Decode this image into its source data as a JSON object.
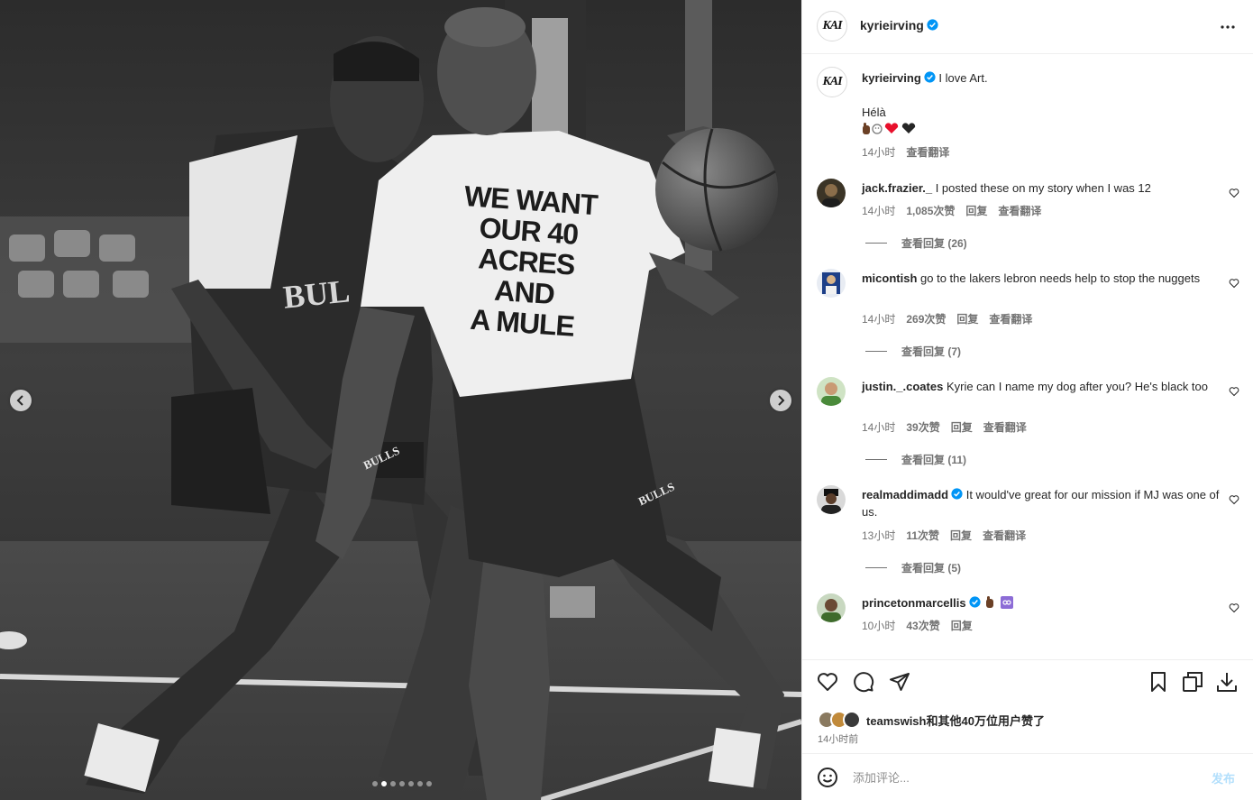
{
  "post": {
    "author": "kyrieirving",
    "avatar_logo": "KAI",
    "caption_line1": "I love Art.",
    "caption_line2": "Hélà",
    "caption_time": "14小时",
    "caption_translate": "查看翻译"
  },
  "media": {
    "shirt_lines": [
      "WE WANT",
      "OUR 40",
      "ACRES",
      "AND",
      "A MULE"
    ],
    "shorts_label": "BULLS",
    "jersey_label": "BUL",
    "carousel_dots": 7,
    "active_dot": 1,
    "prev_icon": "chevron-left-icon",
    "next_icon": "chevron-right-icon"
  },
  "comments": [
    {
      "user": "jack.frazier._",
      "verified": false,
      "text": "I posted these on my story when I was 12",
      "time": "14小时",
      "likes": "1,085次赞",
      "reply": "回复",
      "translate": "查看翻译",
      "replies": "查看回复 (26)",
      "avatar_color": "#3b3426"
    },
    {
      "user": "micontish",
      "verified": false,
      "text": "go to the lakers lebron needs help to stop the nuggets",
      "time": "14小时",
      "likes": "269次赞",
      "reply": "回复",
      "translate": "查看翻译",
      "replies": "查看回复 (7)",
      "avatar_color": "#1d3f88"
    },
    {
      "user": "justin._.coates",
      "verified": false,
      "text": "Kyrie can I name my dog after you? He's black too",
      "time": "14小时",
      "likes": "39次赞",
      "reply": "回复",
      "translate": "查看翻译",
      "replies": "查看回复 (11)",
      "avatar_color": "#4a8a3a"
    },
    {
      "user": "realmaddimadd",
      "verified": true,
      "text": "It would've great for our mission if MJ was one of us.",
      "time": "13小时",
      "likes": "11次赞",
      "reply": "回复",
      "translate": "查看翻译",
      "replies": "查看回复 (5)",
      "avatar_color": "#222222"
    },
    {
      "user": "princetonmarcellis",
      "verified": true,
      "text": "",
      "time": "10小时",
      "likes": "43次赞",
      "reply": "回复",
      "avatar_color": "#3e6b2c"
    }
  ],
  "likes": {
    "user": "teamswish",
    "summary": "和其他40万位用户赞了",
    "time": "14小时前"
  },
  "composer": {
    "placeholder": "添加评论...",
    "post_label": "发布"
  },
  "icons": {
    "like": "heart-icon",
    "comment": "comment-icon",
    "share": "share-icon",
    "save": "bookmark-icon",
    "copy": "copy-icon",
    "download": "download-icon",
    "emoji": "smiley-icon",
    "more": "more-icon",
    "verified": "verified-badge-icon"
  },
  "colors": {
    "verified_blue": "#0095f6",
    "muted_text": "#737373",
    "post_button_disabled": "#b2dffc",
    "divider": "#efefef"
  }
}
